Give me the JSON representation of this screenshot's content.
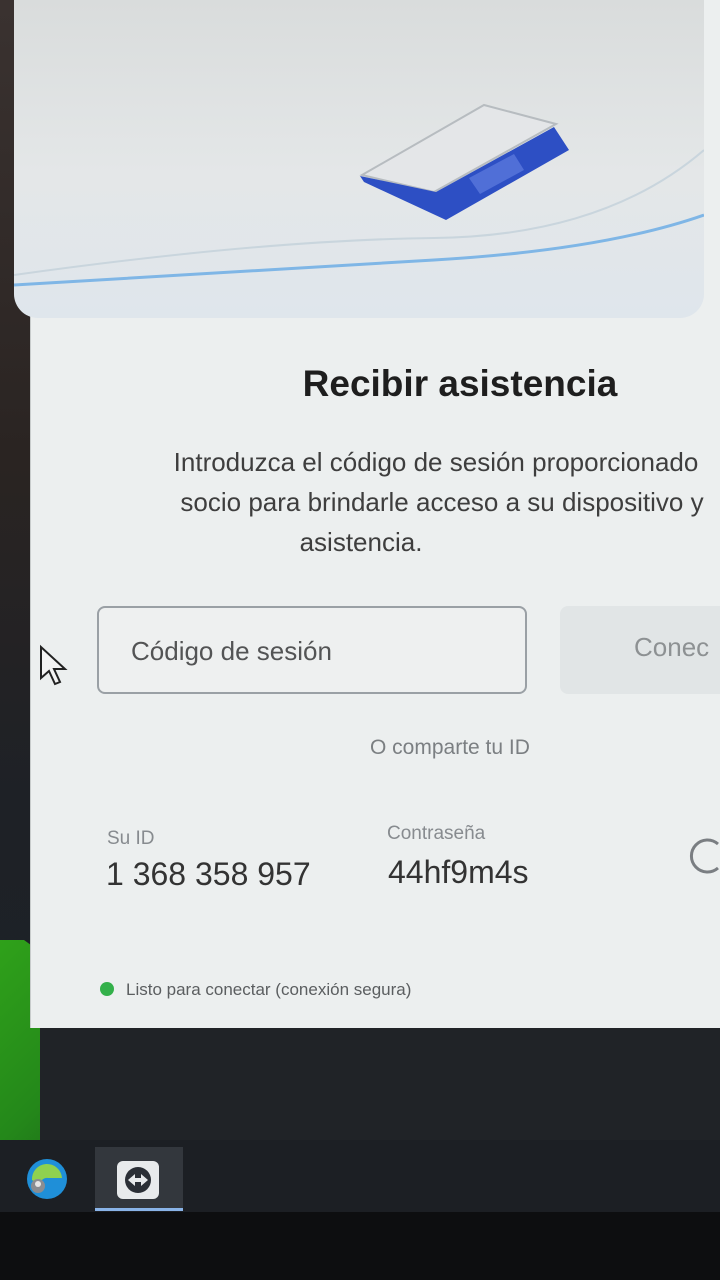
{
  "title": "Recibir asistencia",
  "description": {
    "line1": "Introduzca el código de sesión proporcionado",
    "line2": "socio para brindarle acceso a su dispositivo y",
    "line3": "asistencia."
  },
  "session_input": {
    "placeholder": "Código de sesión"
  },
  "connect_button": {
    "label": "Conec"
  },
  "share_link": "O comparte tu ID",
  "your_id": {
    "label": "Su ID",
    "value": "1 368 358 957"
  },
  "password": {
    "label": "Contraseña",
    "value": "44hf9m4s"
  },
  "status": {
    "text": "Listo para conectar (conexión segura)",
    "color": "#33b04a"
  },
  "taskbar": {
    "icons": [
      "edge-browser-icon",
      "teamviewer-icon"
    ]
  },
  "colors": {
    "accent_blue": "#2d4fc4",
    "window_bg": "#ecefef"
  }
}
